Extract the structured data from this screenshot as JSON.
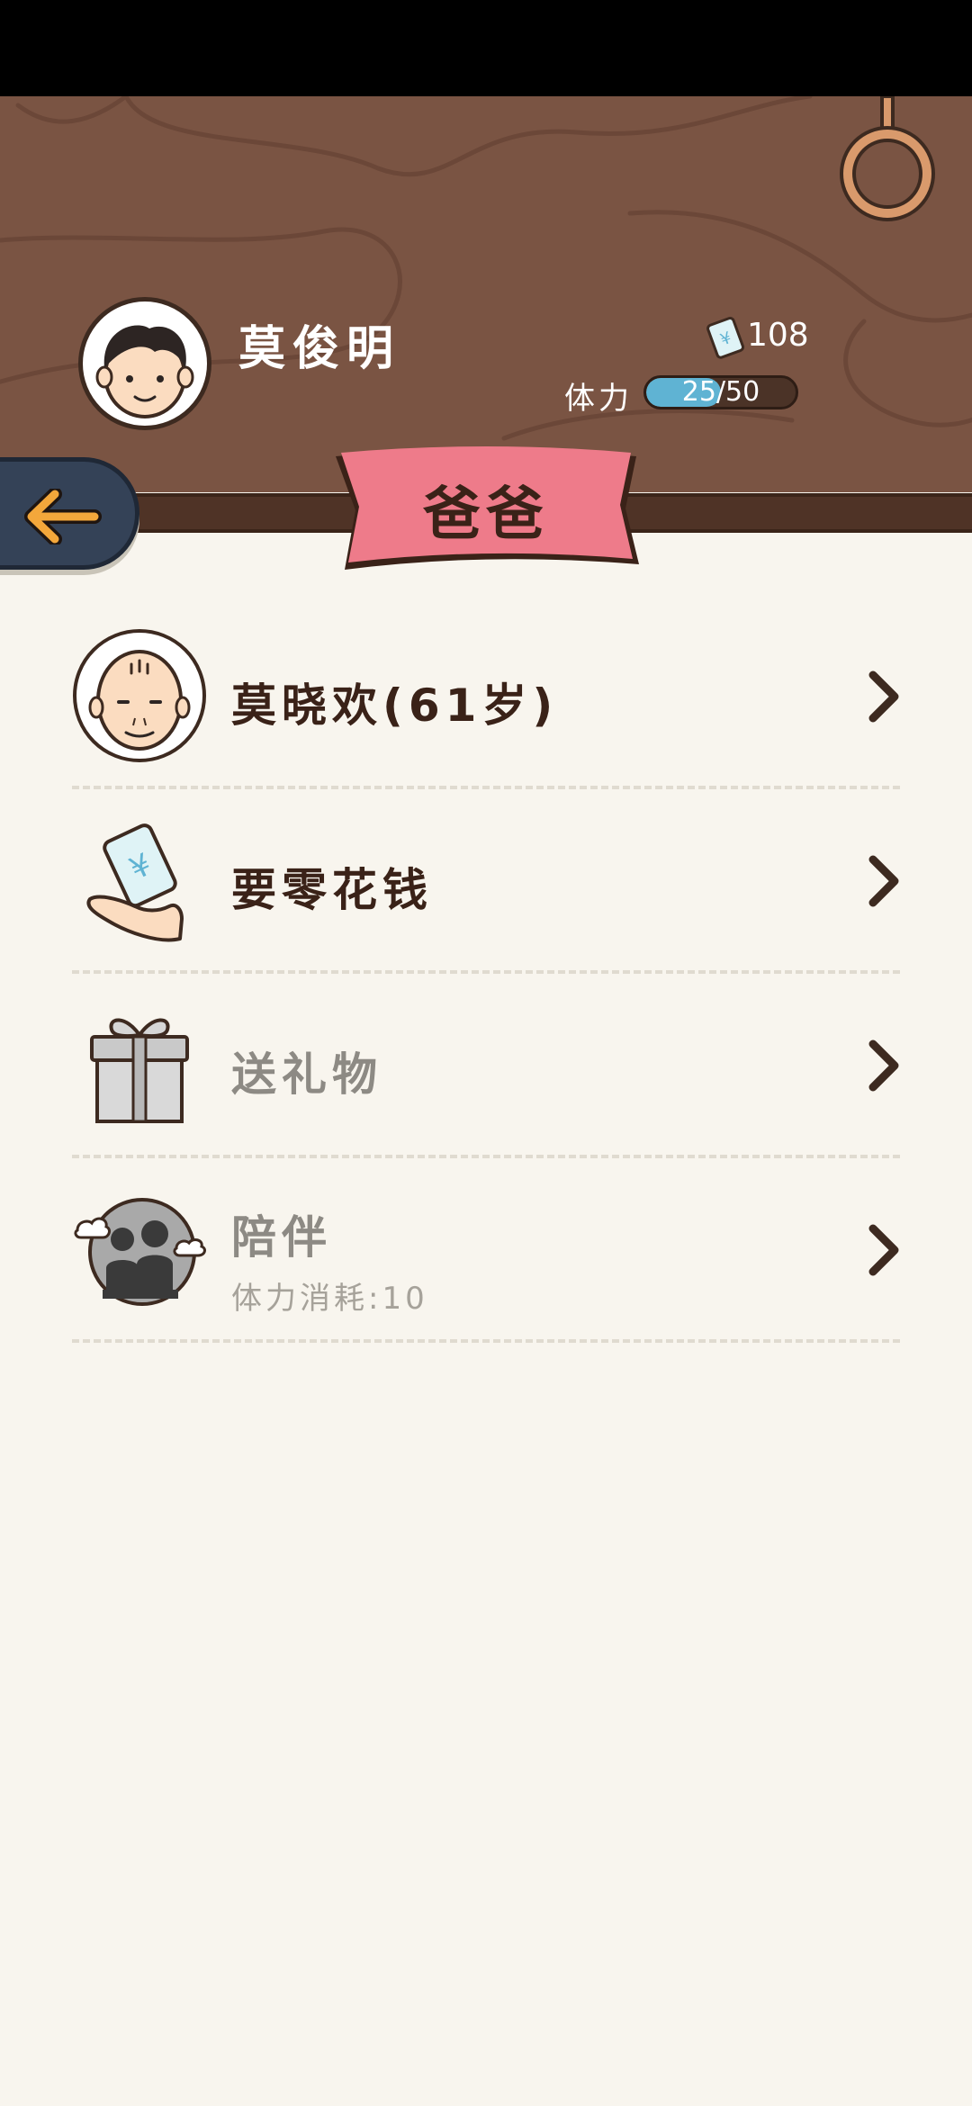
{
  "player": {
    "name": "莫俊明",
    "money": "108",
    "stamina_label": "体力",
    "stamina_current": "25",
    "stamina_max": "50",
    "stamina_fraction": 0.5
  },
  "page": {
    "title": "爸爸"
  },
  "menu": [
    {
      "label": "莫晓欢(61岁)",
      "icon": "grandfather-avatar-icon",
      "enabled": true
    },
    {
      "label": "要零花钱",
      "icon": "hand-money-icon",
      "enabled": true
    },
    {
      "label": "送礼物",
      "icon": "gift-box-icon",
      "enabled": false
    },
    {
      "label": "陪伴",
      "sublabel": "体力消耗:10",
      "icon": "companion-silhouette-icon",
      "enabled": false
    }
  ],
  "colors": {
    "wood": "#7a5443",
    "banner": "#ee7b8a",
    "stamina_fill": "#5fb3d3",
    "back_button": "#344257",
    "arrow": "#f3a73b",
    "text_active": "#3a2218",
    "text_disabled": "#8d8a84"
  }
}
